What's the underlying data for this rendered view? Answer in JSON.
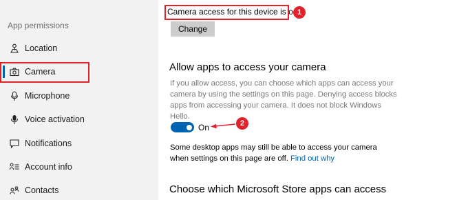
{
  "sidebar": {
    "section_label": "App permissions",
    "items": [
      {
        "label": "Location",
        "icon": "location-icon"
      },
      {
        "label": "Camera",
        "icon": "camera-icon",
        "selected": true
      },
      {
        "label": "Microphone",
        "icon": "microphone-icon"
      },
      {
        "label": "Voice activation",
        "icon": "voice-activation-icon"
      },
      {
        "label": "Notifications",
        "icon": "notifications-icon"
      },
      {
        "label": "Account info",
        "icon": "account-info-icon"
      },
      {
        "label": "Contacts",
        "icon": "contacts-icon"
      }
    ]
  },
  "main": {
    "device_access_status": "Camera access for this device is on",
    "change_button_label": "Change",
    "allow_apps_heading": "Allow apps to access your camera",
    "allow_apps_description": "If you allow access, you can choose which apps can access your camera by using the settings on this page. Denying access blocks apps from accessing your camera. It does not block Windows Hello.",
    "toggle_state_label": "On",
    "desktop_apps_note": "Some desktop apps may still be able to access your camera when settings on this page are off.",
    "find_out_why_link": "Find out why",
    "store_apps_heading": "Choose which Microsoft Store apps can access"
  },
  "annotations": {
    "badge_1": "1",
    "badge_2": "2",
    "highlight_color": "#e2212b"
  },
  "colors": {
    "accent": "#0063b1",
    "sidebar_background": "#f2f2f2",
    "button_background": "#cccccc"
  }
}
